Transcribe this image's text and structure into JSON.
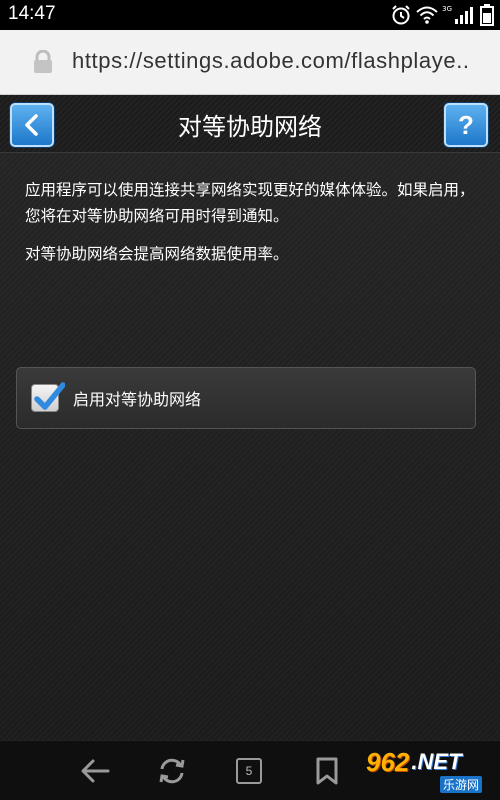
{
  "status_bar": {
    "time": "14:47",
    "network_label": "3G",
    "icons": [
      "alarm-icon",
      "wifi-icon",
      "signal-icon",
      "battery-icon"
    ]
  },
  "browser": {
    "url": "https://settings.adobe.com/flashplaye.."
  },
  "header": {
    "title": "对等协助网络",
    "back_icon": "chevron-left-icon",
    "help_label": "?"
  },
  "main": {
    "description_1": "应用程序可以使用连接共享网络实现更好的媒体体验。如果启用，您将在对等协助网络可用时得到通知。",
    "description_2": "对等协助网络会提高网络数据使用率。",
    "option": {
      "label": "启用对等协助网络",
      "checked": true
    }
  },
  "bottom_nav": {
    "tab_count": "5",
    "buttons": [
      "back-arrow-icon",
      "refresh-icon",
      "tabs-icon",
      "bookmark-icon"
    ]
  },
  "watermark": {
    "number": "962",
    "net": ".NET",
    "subtitle": "乐游网"
  },
  "colors": {
    "accent_blue": "#2f8ae0",
    "background": "#1e1e1e",
    "watermark_orange": "#ffb300"
  }
}
